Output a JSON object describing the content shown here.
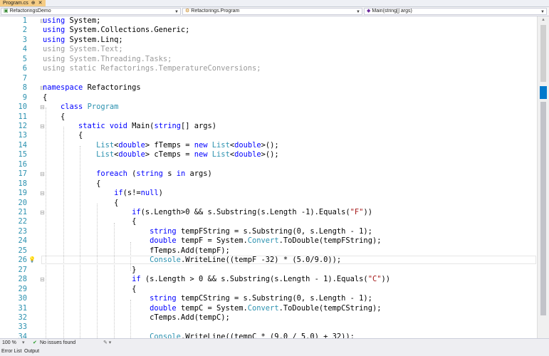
{
  "tab": {
    "label": "Program.cs",
    "pin": "⊕",
    "close": "✕"
  },
  "nav": {
    "project": "RefactoringsDemo",
    "class_selector": "Refactorings.Program",
    "member_selector": "Main(string[] args)"
  },
  "code_lines": [
    {
      "n": "1",
      "html": "<span class='kw'>using</span> System;"
    },
    {
      "n": "2",
      "html": "<span class='kw'>using</span> System.Collections.Generic;"
    },
    {
      "n": "3",
      "html": "<span class='kw'>using</span> System.Linq;"
    },
    {
      "n": "4",
      "html": "<span class='dim2'>using System.Text;</span>"
    },
    {
      "n": "5",
      "html": "<span class='dim2'>using System.Threading.Tasks;</span>"
    },
    {
      "n": "6",
      "html": "<span class='dim2'>using static Refactorings.TemperatureConversions;</span>"
    },
    {
      "n": "7",
      "html": ""
    },
    {
      "n": "8",
      "html": "<span class='kw'>namespace</span> Refactorings"
    },
    {
      "n": "9",
      "html": "{"
    },
    {
      "n": "10",
      "html": "    <span class='kw'>class</span> <span class='ty'>Program</span>"
    },
    {
      "n": "11",
      "html": "    {"
    },
    {
      "n": "12",
      "html": "        <span class='kw'>static</span> <span class='kw'>void</span> Main(<span class='kw'>string</span>[] args)"
    },
    {
      "n": "13",
      "html": "        {"
    },
    {
      "n": "14",
      "html": "            <span class='ty'>List</span>&lt;<span class='kw'>double</span>&gt; fTemps = <span class='kw'>new</span> <span class='ty'>List</span>&lt;<span class='kw'>double</span>&gt;();"
    },
    {
      "n": "15",
      "html": "            <span class='ty'>List</span>&lt;<span class='kw'>double</span>&gt; cTemps = <span class='kw'>new</span> <span class='ty'>List</span>&lt;<span class='kw'>double</span>&gt;();"
    },
    {
      "n": "16",
      "html": ""
    },
    {
      "n": "17",
      "html": "            <span class='kw'>foreach</span> (<span class='kw'>string</span> s <span class='kw'>in</span> args)"
    },
    {
      "n": "18",
      "html": "            {"
    },
    {
      "n": "19",
      "html": "                <span class='kw'>if</span>(s!=<span class='kw'>null</span>)"
    },
    {
      "n": "20",
      "html": "                {"
    },
    {
      "n": "21",
      "html": "                    <span class='kw'>if</span>(s.Length&gt;0 &amp;&amp; s.Substring(s.Length -1).Equals(<span class='st'>\"F\"</span>))"
    },
    {
      "n": "22",
      "html": "                    {"
    },
    {
      "n": "23",
      "html": "                        <span class='kw'>string</span> tempFString = s.Substring(0, s.Length - 1);"
    },
    {
      "n": "24",
      "html": "                        <span class='kw'>double</span> tempF = System.<span class='ty'>Convert</span>.ToDouble(tempFString);"
    },
    {
      "n": "25",
      "html": "                        fTemps.Add(tempF);"
    },
    {
      "n": "26",
      "html": "                        <span class='ty'>Console</span>.WriteLine((tempF -32) * (5.0/9.0));"
    },
    {
      "n": "27",
      "html": "                    }"
    },
    {
      "n": "28",
      "html": "                    <span class='kw'>if</span> (s.Length &gt; 0 &amp;&amp; s.Substring(s.Length - 1).Equals(<span class='st'>\"C\"</span>))"
    },
    {
      "n": "29",
      "html": "                    {"
    },
    {
      "n": "30",
      "html": "                        <span class='kw'>string</span> tempCString = s.Substring(0, s.Length - 1);"
    },
    {
      "n": "31",
      "html": "                        <span class='kw'>double</span> tempC = System.<span class='ty'>Convert</span>.ToDouble(tempCString);"
    },
    {
      "n": "32",
      "html": "                        cTemps.Add(tempC);"
    },
    {
      "n": "33",
      "html": ""
    },
    {
      "n": "34",
      "html": "                        <span class='ty'>Console</span>.WriteLine((tempC * (9.0 / 5.0) + 32));"
    }
  ],
  "status": {
    "zoom": "100 %",
    "issues": "No issues found"
  },
  "bottom_tabs": [
    "Error List",
    "Output"
  ]
}
